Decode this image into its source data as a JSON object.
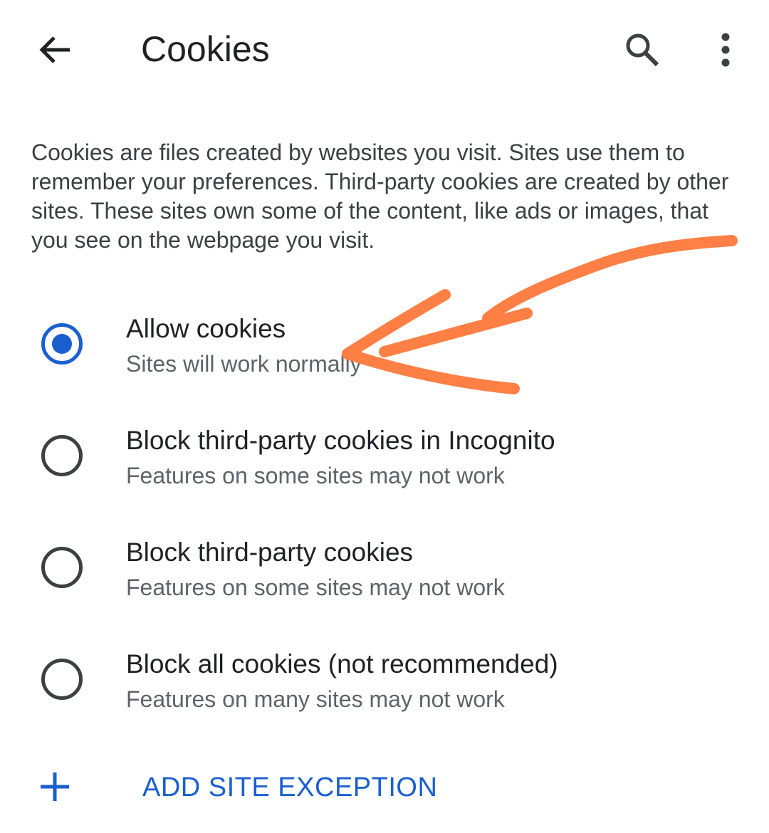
{
  "header": {
    "title": "Cookies",
    "back_icon": "arrow-back-icon",
    "search_icon": "search-icon",
    "menu_icon": "more-vert-icon"
  },
  "description": "Cookies are files created by websites you visit. Sites use them to remember your preferences. Third-party cookies are created by other sites. These sites own some of the content, like ads or images, that you see on the webpage you visit.",
  "options": [
    {
      "title": "Allow cookies",
      "subtitle": "Sites will work normally",
      "selected": true
    },
    {
      "title": "Block third-party cookies in Incognito",
      "subtitle": "Features on some sites may not work",
      "selected": false
    },
    {
      "title": "Block third-party cookies",
      "subtitle": "Features on some sites may not work",
      "selected": false
    },
    {
      "title": "Block all cookies (not recommended)",
      "subtitle": "Features on many sites may not work",
      "selected": false
    }
  ],
  "add_exception": {
    "label": "ADD SITE EXCEPTION",
    "icon": "plus-icon"
  },
  "colors": {
    "accent": "#1a5fd0",
    "annotation": "#ff7f45",
    "text_primary": "#202124",
    "text_secondary": "#5f6368"
  }
}
